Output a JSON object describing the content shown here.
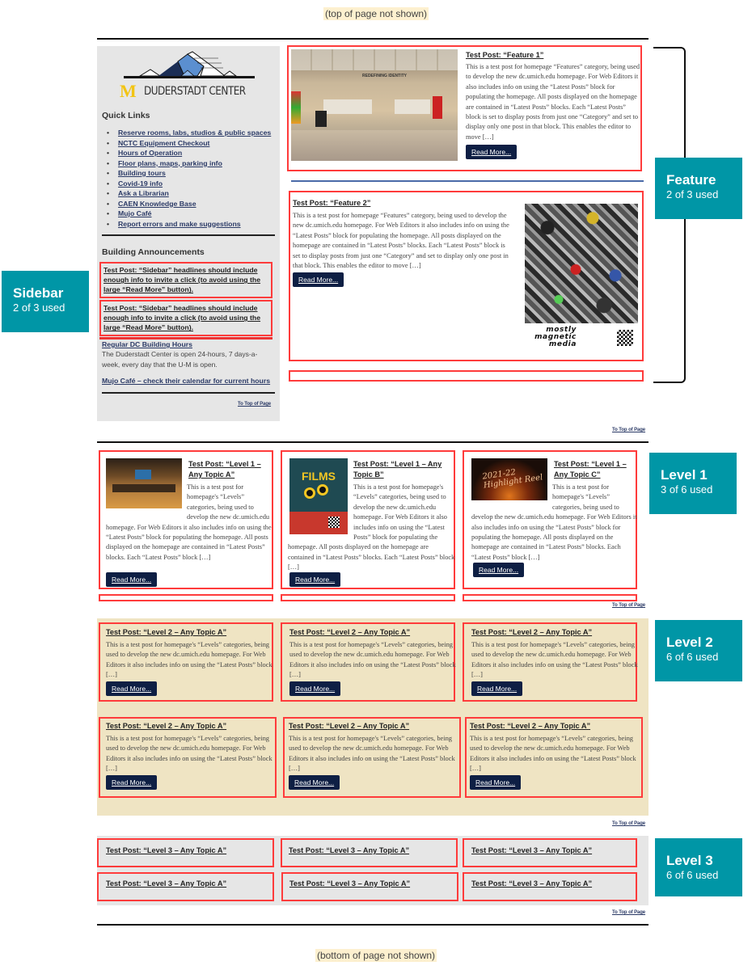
{
  "notes": {
    "top": "(top of page not shown)",
    "bottom": "(bottom  of page not shown)"
  },
  "callouts": {
    "feature": {
      "title": "Feature",
      "sub": "2 of 3 used"
    },
    "sidebar": {
      "title": "Sidebar",
      "sub": "2 of 3 used"
    },
    "level1": {
      "title": "Level 1",
      "sub": "3 of 6 used"
    },
    "level2": {
      "title": "Level 2",
      "sub": "6 of 6 used"
    },
    "level3": {
      "title": "Level 3",
      "sub": "6 of 6 used"
    }
  },
  "colors": {
    "callout": "#0096a6",
    "highlight_border": "#ff3b3b",
    "button": "#0e1f44",
    "link": "#2b3a66",
    "level2_bg": "#efe4c3",
    "sidebar_bg": "#e6e6e6"
  },
  "sidebar": {
    "logo_text": "DUDERSTADT CENTER",
    "logo_mark": "M",
    "quick_links_title": "Quick Links",
    "quick_links": [
      "Reserve rooms, labs, studios & public spaces",
      "NCTC Equipment Checkout",
      "Hours of Operation",
      "Floor plans, maps, parking info",
      "Building tours",
      "Covid-19 info",
      "Ask a Librarian",
      "CAEN Knowledge Base",
      "Mujo Café",
      "Report errors and make suggestions"
    ],
    "announcements_title": "Building Announcements",
    "posts": [
      "Test Post: “Sidebar” headlines should include enough info to invite a click (to avoid using the large “Read More” button).",
      "Test Post: “Sidebar” headlines should include enough info to invite a click (to avoid using the large “Read More” button)."
    ],
    "hours_link": "Regular DC Building Hours",
    "hours_text": "The Duderstadt Center is open 24-hours, 7 days-a-week, every day that the U-M is open.",
    "mujo_link": "Mujo Café – check their calendar for current hours",
    "to_top": "To Top of Page"
  },
  "feature": {
    "posts": [
      {
        "title": "Test Post: “Feature 1”",
        "body": "This is a test post for homepage “Features” category, being used to develop the new dc.umich.edu homepage. For Web Editors it also includes info on using the “Latest Posts” block for populating the homepage. All posts displayed on the homepage are contained in “Latest Posts” blocks. Each “Latest Posts” block is set to display posts from just one “Category” and set to display only one post in that block. This enables the editor to move […]",
        "button": "Read More...",
        "image_caption": "REDEFINING IDENTITY"
      },
      {
        "title": "Test Post: “Feature 2”",
        "body": "This is a test post for homepage “Features” category, being used to develop the new dc.umich.edu homepage. For Web Editors it also includes info on using the “Latest Posts” block for populating the homepage. All posts displayed on the homepage are contained in “Latest Posts” blocks. Each “Latest Posts” block is set to display posts from just one “Category” and set to display only one post in that block. This enables the editor to move […]",
        "button": "Read More...",
        "image_caption": [
          "mostly",
          "magnetic",
          "media"
        ]
      }
    ],
    "to_top": "To Top of Page"
  },
  "level1": {
    "posts": [
      {
        "title": "Test Post: “Level 1 – Any Topic A”",
        "body": "This is a test post for homepage's “Levels” categories, being used to develop the new dc.umich.edu homepage. For Web Editors it also includes info on using the “Latest Posts” block for populating the homepage. All posts displayed on the homepage are contained in “Latest Posts” blocks. Each “Latest Posts” block […]",
        "button": "Read More..."
      },
      {
        "title": "Test Post: “Level 1 – Any Topic B”",
        "body": "This is a test post for homepage's “Levels” categories, being used to develop the new dc.umich.edu homepage. For Web Editors it also includes info on using the “Latest Posts” block for populating the homepage. All posts displayed on the homepage are contained in “Latest Posts” blocks. Each “Latest Posts” block […]",
        "button": "Read More...",
        "image_caption": "FILMS"
      },
      {
        "title": "Test Post: “Level 1 – Any Topic C”",
        "body": "This is a test post for homepage's “Levels” categories, being used to develop the new dc.umich.edu homepage. For Web Editors it also includes info on using the “Latest Posts” block for populating the homepage. All posts displayed on the homepage are contained in “Latest Posts” blocks. Each “Latest Posts” block […]",
        "button": "Read More...",
        "image_caption": "2021-22 Highlight Reel"
      }
    ],
    "to_top": "To Top of Page"
  },
  "level2": {
    "posts": [
      {
        "title": "Test Post: “Level 2 – Any Topic A”",
        "body": "This is a test post for homepage's “Levels” categories, being used to develop the new dc.umich.edu homepage. For Web Editors it also includes info on using the “Latest Posts” block […]",
        "button": "Read More..."
      },
      {
        "title": "Test Post: “Level 2 – Any Topic A”",
        "body": "This is a test post for homepage's “Levels” categories, being used to develop the new dc.umich.edu homepage. For Web Editors it also includes info on using the “Latest Posts” block […]",
        "button": "Read More..."
      },
      {
        "title": "Test Post: “Level 2 – Any Topic A”",
        "body": "This is a test post for homepage's “Levels” categories, being used to develop the new dc.umich.edu homepage. For Web Editors it also includes info on using the “Latest Posts” block […]",
        "button": "Read More..."
      },
      {
        "title": "Test Post: “Level 2 – Any Topic A”",
        "body": "This is a test post for homepage's “Levels” categories, being used to develop the new dc.umich.edu homepage. For Web Editors it also includes info on using the “Latest Posts” block […]",
        "button": "Read More..."
      },
      {
        "title": "Test Post: “Level 2 – Any Topic A”",
        "body": "This is a test post for homepage's “Levels” categories, being used to develop the new dc.umich.edu homepage. For Web Editors it also includes info on using the “Latest Posts” block […]",
        "button": "Read More..."
      },
      {
        "title": "Test Post: “Level 2 – Any Topic A”",
        "body": "This is a test post for homepage's “Levels” categories, being used to develop the new dc.umich.edu homepage. For Web Editors it also includes info on using the “Latest Posts” block […]",
        "button": "Read More..."
      }
    ],
    "to_top": "To Top of Page"
  },
  "level3": {
    "posts": [
      "Test Post: “Level 3 – Any Topic A”",
      "Test Post: “Level 3 – Any Topic A”",
      "Test Post: “Level 3 – Any Topic A”",
      "Test Post: “Level 3 – Any Topic A”",
      "Test Post: “Level 3 – Any Topic A”",
      "Test Post: “Level 3 – Any Topic A”"
    ],
    "to_top": "To Top of Page"
  }
}
